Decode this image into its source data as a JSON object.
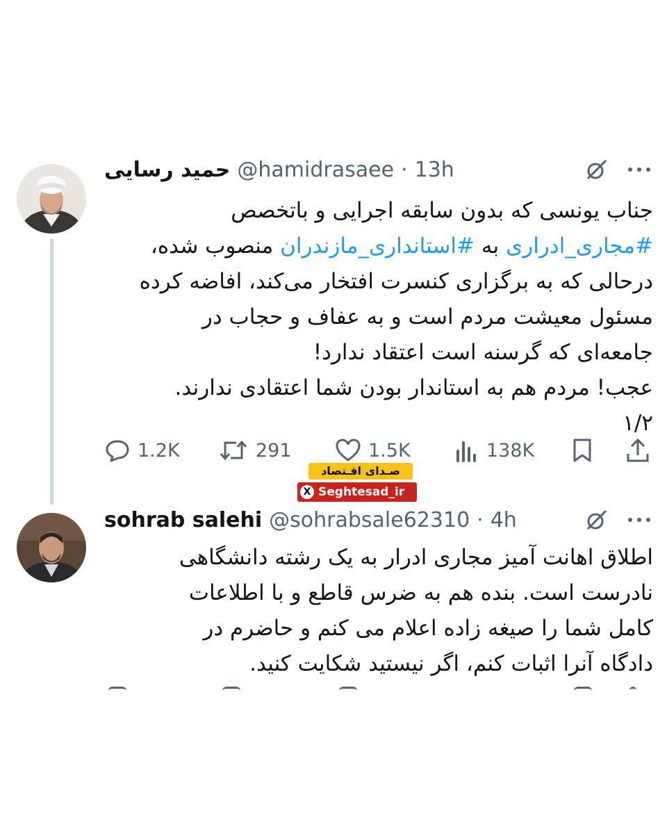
{
  "tweets": [
    {
      "display_name": "حمید رسایی",
      "handle": "@hamidrasaee",
      "separator": "·",
      "time": "13h",
      "avatar_icon": "avatar-cleric",
      "text_lines": [
        {
          "segments": [
            {
              "text": "جناب یونسی که بدون سابقه اجرایی و باتخصص",
              "type": "text"
            }
          ]
        },
        {
          "segments": [
            {
              "text": "#مجاری_ادراری",
              "type": "hashtag"
            },
            {
              "text": " به ",
              "type": "text"
            },
            {
              "text": "#استانداری_مازندران",
              "type": "hashtag"
            },
            {
              "text": " منصوب شده،",
              "type": "text"
            }
          ]
        },
        {
          "segments": [
            {
              "text": "درحالی که به برگزاری کنسرت افتخار می‌کند، افاضه کرده",
              "type": "text"
            }
          ]
        },
        {
          "segments": [
            {
              "text": "مسئول معیشت مردم است و به عفاف و حجاب در",
              "type": "text"
            }
          ]
        },
        {
          "segments": [
            {
              "text": "جامعه‌ای که گرسنه است اعتقاد ندارد!",
              "type": "text"
            }
          ]
        },
        {
          "segments": [
            {
              "text": "عجب! مردم هم به استاندار بودن شما اعتقادی ندارند.",
              "type": "text"
            }
          ]
        },
        {
          "segments": [
            {
              "text": "۱/۲",
              "type": "text"
            }
          ]
        }
      ],
      "actions": {
        "replies": "1.2K",
        "reposts": "291",
        "likes": "1.5K",
        "views": "138K"
      }
    },
    {
      "display_name": "sohrab salehi",
      "handle": "@sohrabsale62310",
      "separator": "·",
      "time": "4h",
      "avatar_icon": "avatar-man",
      "text_lines": [
        {
          "segments": [
            {
              "text": "اطلاق اهانت آمیز مجاری ادرار به یک رشته دانشگاهی",
              "type": "text"
            }
          ]
        },
        {
          "segments": [
            {
              "text": "نادرست است. بنده هم به ضرس قاطع و با اطلاعات",
              "type": "text"
            }
          ]
        },
        {
          "segments": [
            {
              "text": "کامل شما را صیغه زاده اعلام می کنم و حاضرم در",
              "type": "text"
            }
          ]
        },
        {
          "segments": [
            {
              "text": "دادگاه آنرا اثبات کنم، اگر نیستید شکایت کنید.",
              "type": "text"
            }
          ]
        }
      ]
    }
  ],
  "watermark": {
    "title": "صـدای اقـتصاد",
    "x_glyph": "X",
    "handle": "Seghtesad_ir"
  },
  "colors": {
    "text": "#0f1419",
    "secondary": "#536471",
    "hashtag": "#1d9bf0",
    "thread_line": "#cfd9de",
    "watermark_yellow": "#f7c21a",
    "watermark_red": "#c8231f"
  }
}
